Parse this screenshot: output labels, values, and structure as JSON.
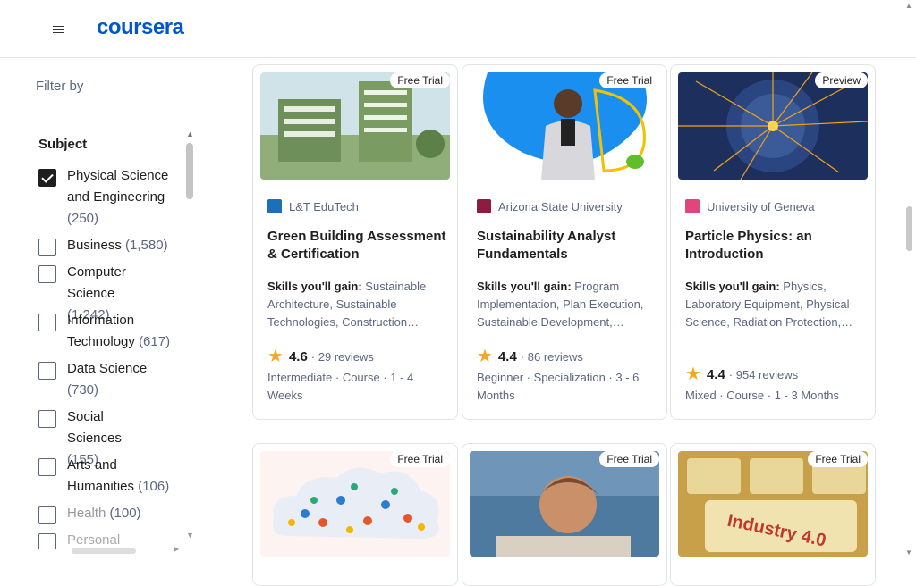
{
  "header": {
    "logo": "coursera"
  },
  "filter": {
    "title": "Filter by",
    "subject_title": "Subject",
    "items": [
      {
        "label": "Physical Science and Engineering",
        "count": "(250)",
        "checked": true
      },
      {
        "label": "Business",
        "count": "(1,580)",
        "checked": false
      },
      {
        "label": "Computer Science",
        "count": "(1,242)",
        "checked": false
      },
      {
        "label": "Information Technology",
        "count": "(617)",
        "checked": false
      },
      {
        "label": "Data Science",
        "count": "(730)",
        "checked": false
      },
      {
        "label": "Social Sciences",
        "count": "(155)",
        "checked": false
      },
      {
        "label": "Arts and Humanities",
        "count": "(106)",
        "checked": false
      },
      {
        "label": "Health",
        "count": "(100)",
        "checked": false
      },
      {
        "label": "Personal",
        "count": "",
        "checked": false
      }
    ]
  },
  "cards": [
    {
      "badge": "Free Trial",
      "partner": "L&T EduTech",
      "title": "Green Building Assessment & Certification",
      "skills_label": "Skills you'll gain:",
      "skills": "Sustainable Architecture, Sustainable Technologies, Construction…",
      "rating": "4.6",
      "reviews": "29 reviews",
      "meta": "Intermediate · Course · 1 - 4 Weeks"
    },
    {
      "badge": "Free Trial",
      "partner": "Arizona State University",
      "title": "Sustainability Analyst Fundamentals",
      "skills_label": "Skills you'll gain:",
      "skills": "Program Implementation, Plan Execution, Sustainable Development,…",
      "rating": "4.4",
      "reviews": "86 reviews",
      "meta": "Beginner · Specialization · 3 - 6 Months"
    },
    {
      "badge": "Preview",
      "partner": "University of Geneva",
      "title": "Particle Physics: an Introduction",
      "skills_label": "Skills you'll gain:",
      "skills": "Physics, Laboratory Equipment, Physical Science, Radiation Protection,…",
      "rating": "4.4",
      "reviews": "954 reviews",
      "meta": "Mixed · Course · 1 - 3 Months"
    },
    {
      "badge": "Free Trial"
    },
    {
      "badge": "Free Trial"
    },
    {
      "badge": "Free Trial",
      "image_text": "Industry 4.0"
    }
  ],
  "colors": {
    "brand": "#0056d2",
    "star": "#f5a623",
    "muted": "#5b6780"
  }
}
